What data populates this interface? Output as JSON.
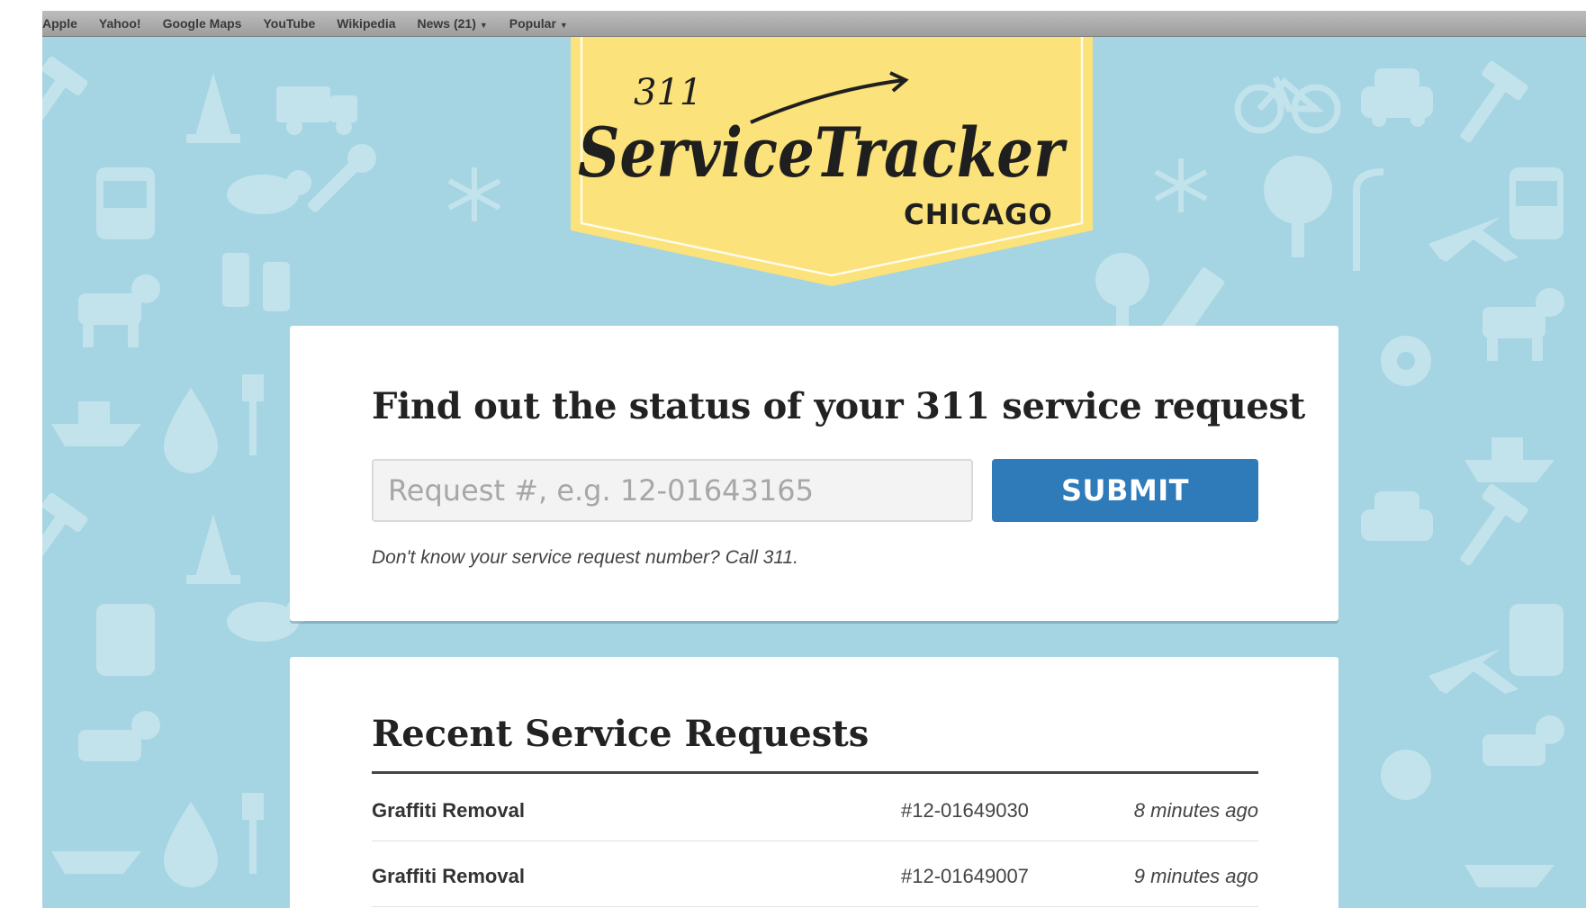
{
  "bookmarks": [
    {
      "label": "Apple"
    },
    {
      "label": "Yahoo!"
    },
    {
      "label": "Google Maps"
    },
    {
      "label": "YouTube"
    },
    {
      "label": "Wikipedia"
    },
    {
      "label": "News (21)",
      "dropdown": true
    },
    {
      "label": "Popular",
      "dropdown": true
    }
  ],
  "logo": {
    "number": "311",
    "title_script": "ServiceTracker",
    "city": "CHICAGO",
    "banner_color": "#fbe27a",
    "ink_color": "#1f1f1f"
  },
  "search": {
    "heading": "Find out the status of your 311 service request",
    "placeholder": "Request #, e.g. 12-01643165",
    "value": "",
    "submit_label": "SUBMIT",
    "help_text": "Don't know your service request number? Call 311."
  },
  "recent": {
    "heading": "Recent Service Requests",
    "rows": [
      {
        "type": "Graffiti Removal",
        "number": "#12-01649030",
        "time": "8 minutes ago"
      },
      {
        "type": "Graffiti Removal",
        "number": "#12-01649007",
        "time": "9 minutes ago"
      }
    ]
  },
  "colors": {
    "background": "#a5d4e2",
    "pattern_icons": "#c2e3ec",
    "accent_button": "#2f7ab8"
  },
  "background_icons": [
    "hammer-icon",
    "traffic-cone-icon",
    "truck-icon",
    "bicycle-icon",
    "car-icon",
    "snowflake-icon",
    "tree-icon",
    "streetlight-icon",
    "bus-icon",
    "airplane-icon",
    "water-drop-icon",
    "fork-icon",
    "rat-icon",
    "dog-icon",
    "gear-icon",
    "parking-meter-icon",
    "wrench-icon",
    "boat-icon"
  ]
}
